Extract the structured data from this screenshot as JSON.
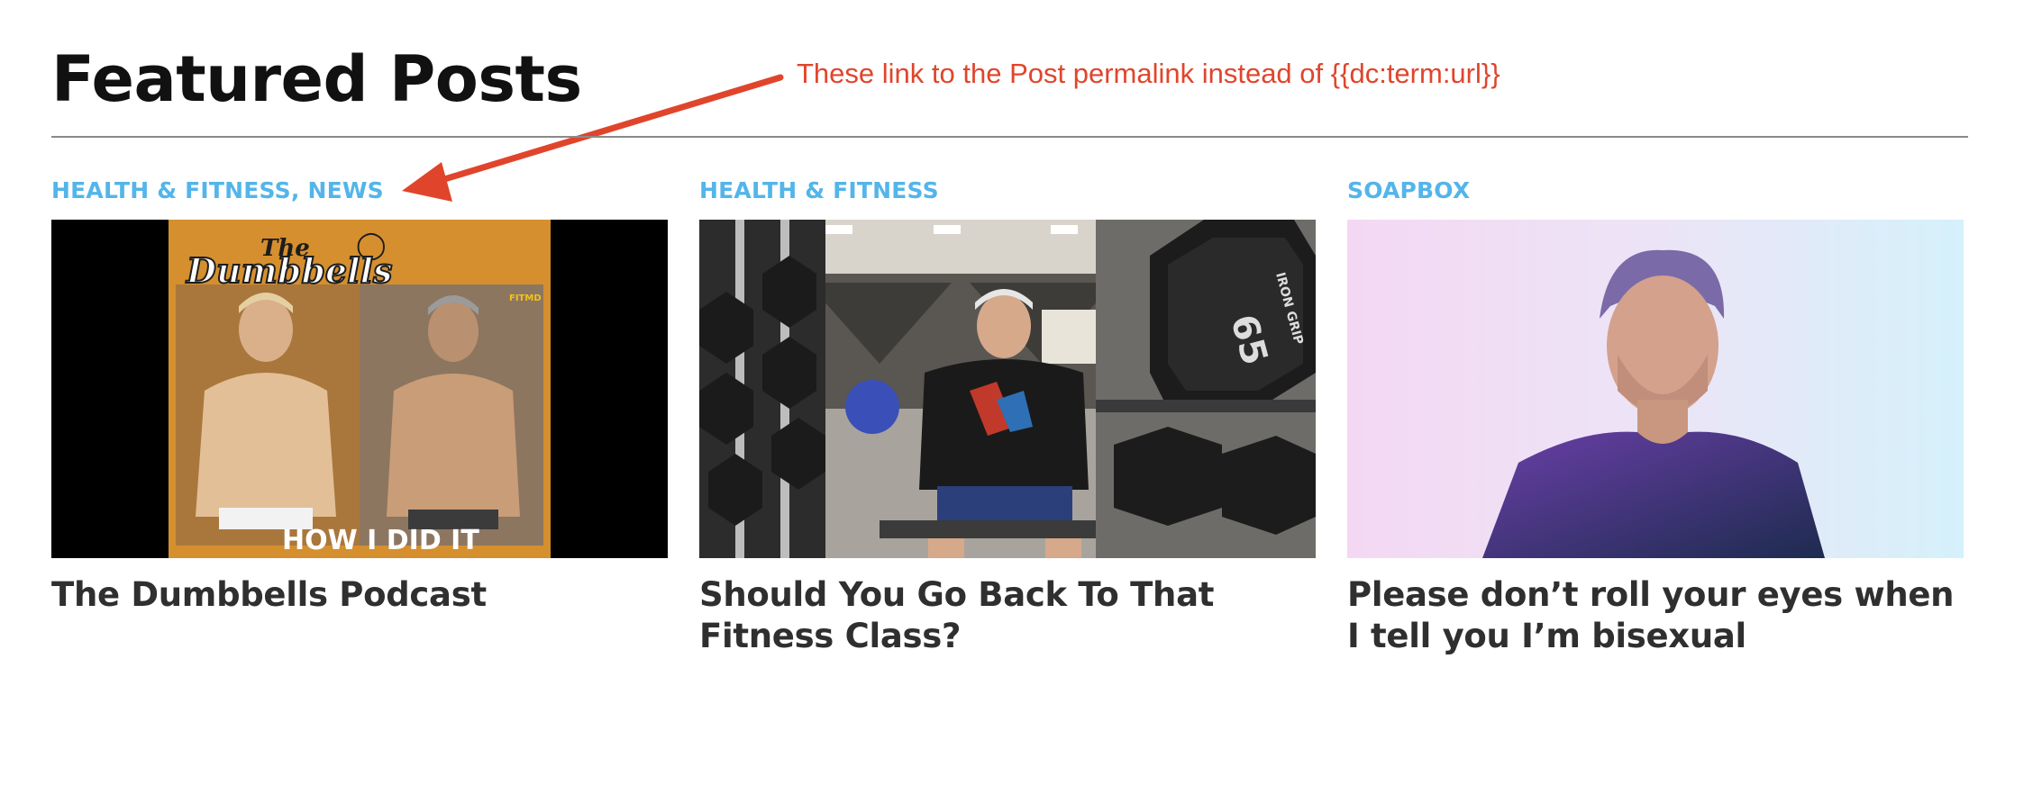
{
  "section": {
    "title": "Featured Posts"
  },
  "annotation": {
    "text": "These link to the Post permalink instead of {{dc:term:url}}",
    "color": "#e0452c"
  },
  "colors": {
    "category": "#53b5ea",
    "title_text": "#2f2f2f",
    "heading": "#111111",
    "rule": "#8a8a8a"
  },
  "posts": [
    {
      "category": "HEALTH & FITNESS, NEWS",
      "title": "The Dumbbells Podcast",
      "image": {
        "logo_the": "The",
        "logo_name": "Dumbbells",
        "badge": "FITMD",
        "caption": "HOW I DID IT"
      }
    },
    {
      "category": "HEALTH & FITNESS",
      "title": "Should You Go Back To That Fitness Class?",
      "image": {
        "plate_number": "65",
        "plate_brand": "IRON GRIP"
      }
    },
    {
      "category": "SOAPBOX",
      "title": "Please don’t roll your eyes when I tell you I’m bisexual",
      "image": {}
    }
  ]
}
